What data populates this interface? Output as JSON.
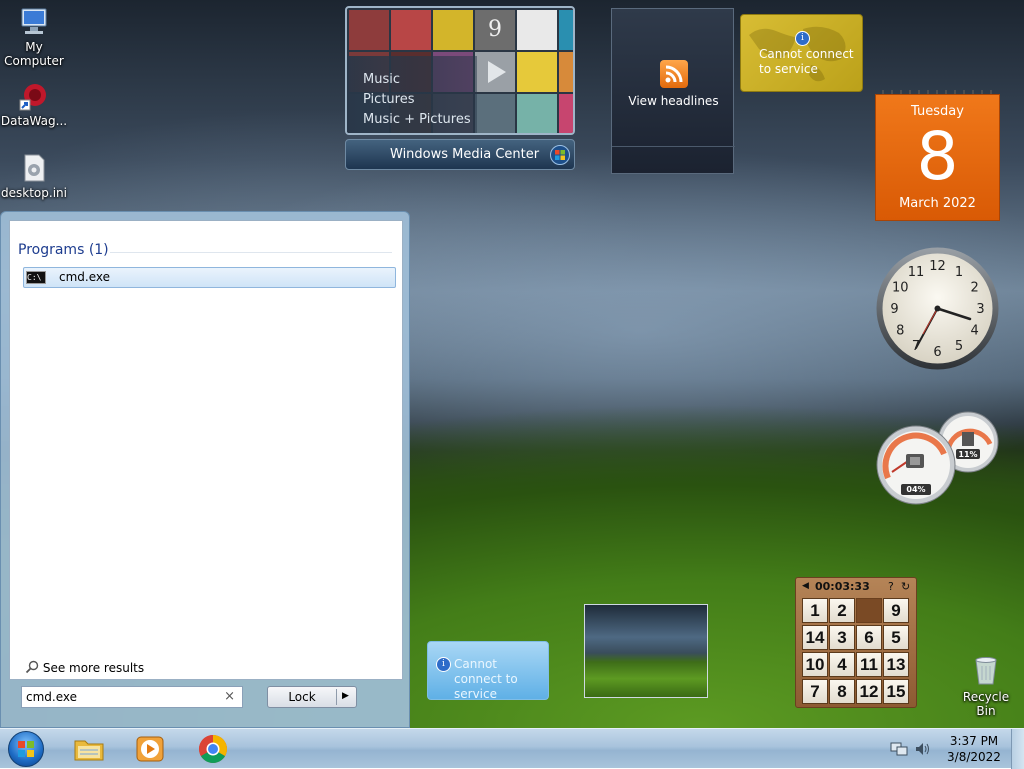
{
  "desktop": {
    "icons": [
      {
        "label": "My Computer",
        "icon": "computer-icon"
      },
      {
        "label": "DataWag...",
        "icon": "app-shortcut-icon"
      },
      {
        "label": "desktop.ini",
        "icon": "settings-file-icon"
      }
    ],
    "recycle_bin": {
      "label": "Recycle Bin",
      "icon": "recycle-bin-icon"
    }
  },
  "start_menu": {
    "programs_heading": "Programs (1)",
    "results": [
      {
        "label": "cmd.exe",
        "icon": "command-prompt-icon"
      }
    ],
    "see_more": "See more results",
    "search": {
      "value": "cmd.exe",
      "clear_glyph": "×"
    },
    "lock_button": "Lock"
  },
  "gadgets": {
    "media_center": {
      "items": [
        "Music",
        "Pictures",
        "Music + Pictures"
      ],
      "brand": "Windows Media Center"
    },
    "feed": {
      "label": "View headlines"
    },
    "weather_top": {
      "message": "Cannot connect to service"
    },
    "weather_bottom": {
      "message": "Cannot connect to service"
    },
    "calendar": {
      "day_name": "Tuesday",
      "day": "8",
      "month_year": "March 2022"
    },
    "clock": {
      "numbers": [
        "12",
        "1",
        "2",
        "3",
        "4",
        "5",
        "6",
        "7",
        "8",
        "9",
        "10",
        "11"
      ]
    },
    "cpu_meter": {
      "cpu": "04%",
      "memory": "11%"
    },
    "puzzle": {
      "timer": "00:03:33",
      "tiles": [
        "1",
        "2",
        "",
        "9",
        "14",
        "3",
        "6",
        "5",
        "10",
        "4",
        "11",
        "13",
        "7",
        "8",
        "12",
        "15"
      ]
    }
  },
  "taskbar": {
    "pinned": [
      {
        "name": "taskbar-file-explorer",
        "icon": "folder-icon"
      },
      {
        "name": "taskbar-media-player",
        "icon": "media-player-icon"
      },
      {
        "name": "taskbar-chrome",
        "icon": "chrome-icon"
      }
    ],
    "time": "3:37 PM",
    "date": "3/8/2022"
  },
  "colors": {
    "accent_orange": "#e2660c",
    "selection_blue": "#cfe4f7",
    "taskbar": "#a8c3dc"
  }
}
